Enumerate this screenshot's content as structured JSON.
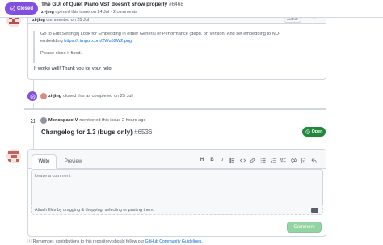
{
  "issue": {
    "state": "Closed",
    "title": "The GUI of Quiet Piano VST doesn't show properly",
    "number": "#6468",
    "opener": "zi-jing",
    "opened_text": "opened this issue on 24 Jul · 2 comments"
  },
  "comment": {
    "author": "zi-jing",
    "time_text": "commented on 25 Jul",
    "author_label": "Author",
    "menu": "···",
    "quote_line1": "Go to Edit Settings] Look for Embedding in either General or Performance (depd. on version) And set embedding to NO-",
    "quote_line2": "embedding",
    "quote_link": "https://i.imgur.com/2Wu52W2.png",
    "quote_line3": "Please close if fixed.",
    "reply": "It works well! Thank you for your help."
  },
  "closed_event": {
    "actor": "zi-jing",
    "text": "closed this as completed on 25 Jul"
  },
  "mention_event": {
    "actor": "Monospace-V",
    "text": "mentioned this issue 2 hours ago",
    "ref_title": "Changelog for 1.3 (bugs only)",
    "ref_number": "#6536",
    "ref_state": "Open"
  },
  "editor": {
    "tab_write": "Write",
    "tab_preview": "Preview",
    "toolbar_icons": [
      "heading-icon",
      "bold-icon",
      "italic-icon",
      "quote-icon",
      "code-icon",
      "link-icon",
      "unordered-list-icon",
      "ordered-list-icon",
      "task-list-icon",
      "mention-icon",
      "reference-icon",
      "reply-icon"
    ],
    "placeholder": "Leave a comment",
    "attach_text": "Attach files by dragging & dropping, selecting or pasting them.",
    "submit": "Comment"
  },
  "footer": {
    "text": "Remember, contributions to this repository should follow our",
    "link": "GitHub Community Guidelines."
  },
  "colors": {
    "closed_purple": "#8250df",
    "open_green": "#1f883d",
    "link_blue": "#0969da",
    "button_disabled_green": "#94d3a2"
  }
}
